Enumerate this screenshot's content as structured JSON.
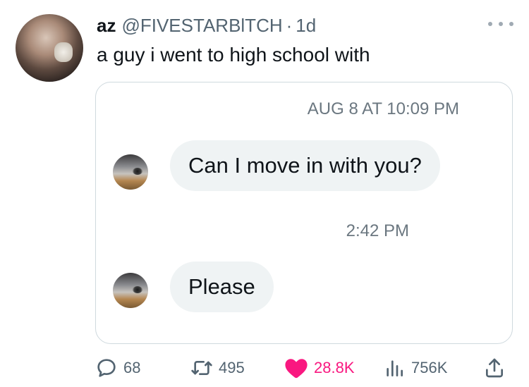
{
  "tweet": {
    "display_name": "az",
    "handle": "@FIVESTARBlTCH",
    "separator": "·",
    "time_ago": "1d",
    "text": "a guy i went to high school with"
  },
  "embed": {
    "timestamp_1": "AUG 8 AT 10:09 PM",
    "message_1": "Can I move in with you?",
    "timestamp_2": "2:42 PM",
    "message_2": "Please"
  },
  "actions": {
    "replies": "68",
    "retweets": "495",
    "likes": "28.8K",
    "views": "756K"
  },
  "icons": {
    "reply": "reply-icon",
    "retweet": "retweet-icon",
    "like": "heart-icon",
    "views": "views-icon",
    "share": "share-icon",
    "more": "more-options-icon"
  },
  "colors": {
    "like_active": "#f91880",
    "muted_text": "#536471",
    "bubble_bg": "#eff3f4"
  }
}
